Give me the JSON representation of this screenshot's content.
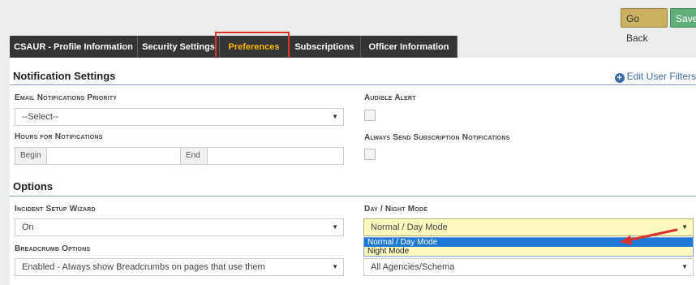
{
  "toolbar": {
    "go_back_label": "Go Back",
    "save_label": "Save"
  },
  "tabs": [
    {
      "label": "CSAUR - Profile Information"
    },
    {
      "label": "Security Settings"
    },
    {
      "label": "Preferences"
    },
    {
      "label": "Subscriptions"
    },
    {
      "label": "Officer Information"
    }
  ],
  "notification": {
    "title": "Notification Settings",
    "edit_link": "Edit User Filters",
    "email_priority": {
      "label": "Email Notifications Priority",
      "value": "--Select--"
    },
    "hours": {
      "label": "Hours for Notifications",
      "begin_label": "Begin",
      "end_label": "End"
    },
    "audible_alert": {
      "label": "Audible Alert"
    },
    "always_send": {
      "label": "Always Send Subscription Notifications"
    }
  },
  "options": {
    "title": "Options",
    "wizard": {
      "label": "Incident Setup Wizard",
      "value": "On"
    },
    "breadcrumb": {
      "label": "Breadcrumb Options",
      "value": "Enabled - Always show Breadcrumbs on pages that use them"
    },
    "day_night": {
      "label": "Day / Night Mode",
      "value": "Normal / Day Mode",
      "options": [
        "Normal / Day Mode",
        "Night Mode"
      ]
    },
    "agencies": {
      "value": "All Agencies/Schema"
    }
  },
  "colors": {
    "tab_bg": "#353535",
    "active_tab_text": "#f5b800",
    "highlight_red": "#d9332b",
    "link_blue": "#3e6aa8",
    "select_highlight": "#fdf9bf",
    "option_selected": "#1e78d6"
  },
  "icons": {
    "edit_link": "plus-circle-icon",
    "select_arrow": "caret-down-icon"
  }
}
